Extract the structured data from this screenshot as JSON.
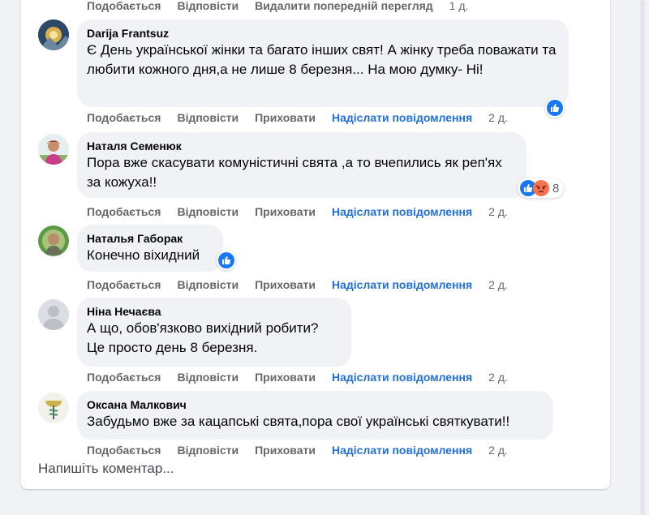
{
  "top_actions": {
    "like": "Подобається",
    "reply": "Відповісти",
    "remove_preview": "Видалити попередній перегляд",
    "time": "1 д."
  },
  "action_labels": {
    "like": "Подобається",
    "reply": "Відповісти",
    "hide": "Приховати",
    "send_message": "Надіслати повідомлення"
  },
  "comments": [
    {
      "author": "Darija Frantsuz",
      "text": "Є День української жінки та багато інших свят! А жінку треба поважати та любити кожного дня,а не лише 8 березня... На мою думку- Ні!",
      "time": "2 д.",
      "reactions": [
        "like"
      ],
      "reaction_count": ""
    },
    {
      "author": "Наталя Семенюк",
      "text": "Пора вже скасувати комуністичні свята ,а то вчепились як реп'ях за кожуха!!",
      "time": "2 д.",
      "reactions": [
        "like",
        "angry"
      ],
      "reaction_count": "8"
    },
    {
      "author": "Наталья Габорак",
      "text": "Конечно віхидний",
      "time": "2 д.",
      "reactions": [
        "like"
      ],
      "reaction_count": ""
    },
    {
      "author": "Ніна Нечаєва",
      "text_lines": [
        "А що, обов'язково вихідний робити?",
        "Це просто день 8 березня."
      ],
      "time": "2 д.",
      "reactions": [],
      "reaction_count": ""
    },
    {
      "author": "Оксана Малкович",
      "text": "Забудьмо вже за кацапські свята,пора свої українські святкувати!!",
      "time": "2 д.",
      "reactions": [],
      "reaction_count": ""
    }
  ],
  "comment_input": {
    "placeholder": "Напишіть коментар..."
  },
  "colors": {
    "like_blue": "#1877f2",
    "angry_orange": "#f7714c",
    "link_blue": "#216fdb",
    "bubble_bg": "#f0f2f5"
  }
}
